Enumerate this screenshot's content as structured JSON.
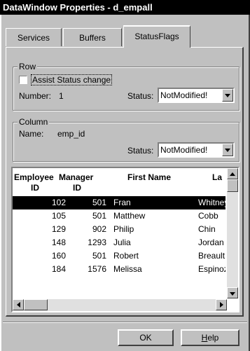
{
  "window": {
    "title": "DataWindow Properties -  d_empall"
  },
  "tabs": [
    {
      "label": "Services"
    },
    {
      "label": "Buffers"
    },
    {
      "label": "StatusFlags"
    }
  ],
  "row_group": {
    "legend": "Row",
    "assist_label": "Assist Status change",
    "assist_checked": false,
    "number_label": "Number:",
    "number_value": "1",
    "status_label": "Status:",
    "status_value": "NotModified!"
  },
  "column_group": {
    "legend": "Column",
    "name_label": "Name:",
    "name_value": "emp_id",
    "status_label": "Status:",
    "status_value": "NotModified!"
  },
  "grid": {
    "headers": [
      {
        "line1": "Employee",
        "line2": "ID"
      },
      {
        "line1": "Manager",
        "line2": "ID"
      },
      {
        "line1": "First Name",
        "line2": ""
      },
      {
        "line1": "La",
        "line2": ""
      }
    ],
    "rows": [
      {
        "emp_id": "102",
        "manager_id": "501",
        "first_name": "Fran",
        "last_name": "Whitney",
        "selected": true
      },
      {
        "emp_id": "105",
        "manager_id": "501",
        "first_name": "Matthew",
        "last_name": "Cobb",
        "selected": false
      },
      {
        "emp_id": "129",
        "manager_id": "902",
        "first_name": "Philip",
        "last_name": "Chin",
        "selected": false
      },
      {
        "emp_id": "148",
        "manager_id": "1293",
        "first_name": "Julia",
        "last_name": "Jordan",
        "selected": false
      },
      {
        "emp_id": "160",
        "manager_id": "501",
        "first_name": "Robert",
        "last_name": "Breault",
        "selected": false
      },
      {
        "emp_id": "184",
        "manager_id": "1576",
        "first_name": "Melissa",
        "last_name": "Espinoza",
        "selected": false
      }
    ]
  },
  "buttons": {
    "ok_label": "OK",
    "help_label": "Help"
  },
  "colors": {
    "face": "#c0c0c0",
    "title_bg": "#000000",
    "selection_bg": "#000000",
    "selection_fg": "#ffffff"
  }
}
